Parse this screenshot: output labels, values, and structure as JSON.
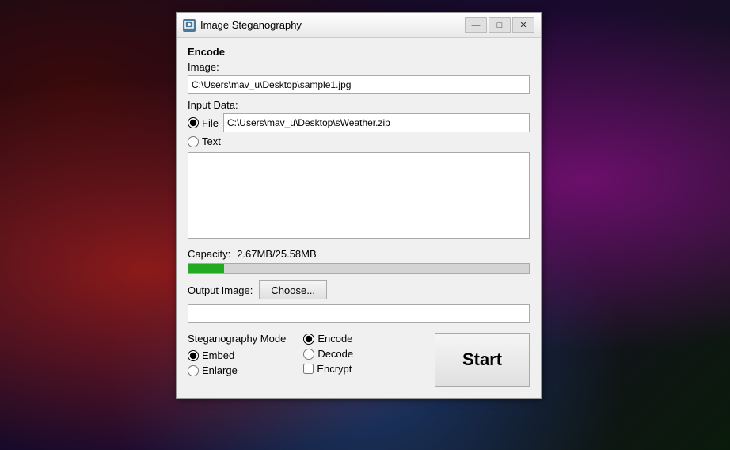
{
  "app": {
    "title": "Image Steganography",
    "icon": "steg-icon"
  },
  "titlebar": {
    "minimize_label": "—",
    "maximize_label": "□",
    "close_label": "✕"
  },
  "encode": {
    "section_label": "Encode",
    "image_label": "Image:",
    "image_value": "C:\\Users\\mav_u\\Desktop\\sample1.jpg",
    "input_data_label": "Input Data:",
    "file_label": "File",
    "file_value": "C:\\Users\\mav_u\\Desktop\\sWeather.zip",
    "text_label": "Text",
    "text_value": "",
    "capacity_label": "Capacity:",
    "capacity_value": "2.67MB/25.58MB",
    "progress_percent": 10.4,
    "output_image_label": "Output Image:",
    "choose_label": "Choose...",
    "output_image_value": ""
  },
  "steganography_mode": {
    "label": "Steganography Mode",
    "embed_label": "Embed",
    "embed_checked": true,
    "enlarge_label": "Enlarge",
    "enlarge_checked": false
  },
  "encode_decode": {
    "encode_label": "Encode",
    "encode_checked": true,
    "decode_label": "Decode",
    "decode_checked": false,
    "encrypt_label": "Encrypt",
    "encrypt_checked": false
  },
  "start_button": {
    "label": "Start"
  }
}
